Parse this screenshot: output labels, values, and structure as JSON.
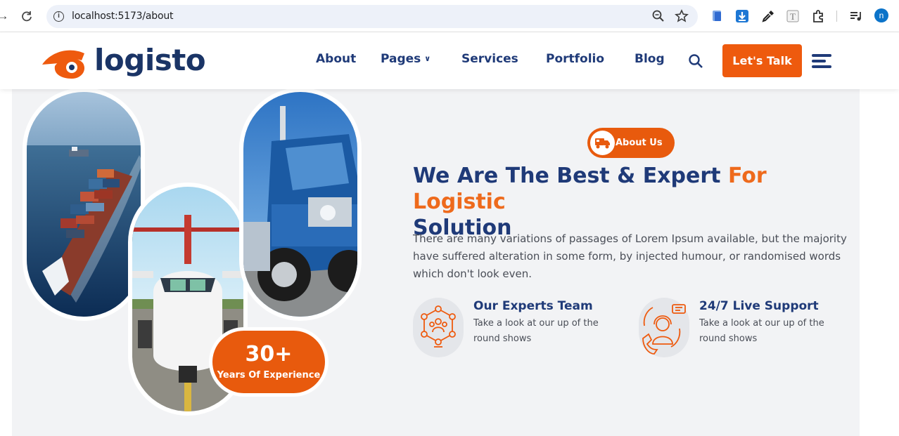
{
  "browser": {
    "url": "localhost:5173/about",
    "profile_initial": "n"
  },
  "header": {
    "logo_text": "logisto",
    "nav": [
      {
        "label": "About"
      },
      {
        "label": "Pages"
      },
      {
        "label": "Services"
      },
      {
        "label": "Portfolio"
      },
      {
        "label": "Blog"
      }
    ],
    "cta_label": "Let's Talk"
  },
  "colors": {
    "primary_navy": "#1f3a78",
    "accent_orange": "#ee5a0e",
    "section_bg": "#f2f3f5"
  },
  "hero": {
    "images": [
      "container-ship-image",
      "airplane-image",
      "truck-image"
    ],
    "experience": {
      "number": "30+",
      "label": "Years Of Experience"
    },
    "tag": "About Us",
    "headline_main": "We Are The Best & Expert",
    "headline_accent": "For Logistic",
    "headline_end": "Solution",
    "paragraph": "There are many variations of passages of Lorem Ipsum available, but the majority have suffered alteration in some form, by injected humour, or randomised words which don't look even.",
    "features": [
      {
        "icon": "team-network-icon",
        "title": "Our Experts Team",
        "description": "Take a look at our up of the round shows"
      },
      {
        "icon": "support-agent-icon",
        "title": "24/7 Live Support",
        "description": "Take a look at our up of the round shows"
      }
    ]
  }
}
